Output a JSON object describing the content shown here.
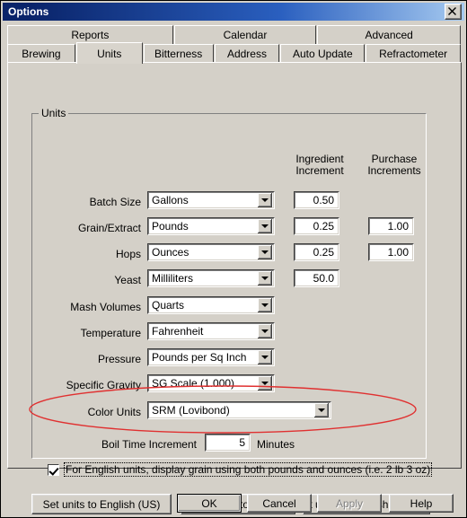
{
  "window": {
    "title": "Options",
    "close_icon": "close-icon"
  },
  "tabs": {
    "top_row": [
      {
        "label": "Reports",
        "selected": false
      },
      {
        "label": "Calendar",
        "selected": false
      },
      {
        "label": "Advanced",
        "selected": false
      }
    ],
    "bottom_row": [
      {
        "label": "Brewing",
        "selected": false
      },
      {
        "label": "Units",
        "selected": true
      },
      {
        "label": "Bitterness",
        "selected": false
      },
      {
        "label": "Address",
        "selected": false
      },
      {
        "label": "Auto Update",
        "selected": false
      },
      {
        "label": "Refractometer",
        "selected": false
      }
    ]
  },
  "group": {
    "legend": "Units",
    "columns": {
      "ingredient": "Ingredient\nIncrement",
      "ingredient_line1": "Ingredient",
      "ingredient_line2": "Increment",
      "purchase_line1": "Purchase",
      "purchase_line2": "Increments"
    },
    "rows": [
      {
        "label": "Batch Size",
        "unit": "Gallons",
        "ingredient": "0.50",
        "purchase": ""
      },
      {
        "label": "Grain/Extract",
        "unit": "Pounds",
        "ingredient": "0.25",
        "purchase": "1.00"
      },
      {
        "label": "Hops",
        "unit": "Ounces",
        "ingredient": "0.25",
        "purchase": "1.00"
      },
      {
        "label": "Yeast",
        "unit": "Milliliters",
        "ingredient": "50.0",
        "purchase": ""
      },
      {
        "label": "Mash Volumes",
        "unit": "Quarts",
        "ingredient": "",
        "purchase": ""
      },
      {
        "label": "Temperature",
        "unit": "Fahrenheit",
        "ingredient": "",
        "purchase": ""
      },
      {
        "label": "Pressure",
        "unit": "Pounds per Sq Inch",
        "ingredient": "",
        "purchase": ""
      },
      {
        "label": "Specific Gravity",
        "unit": "SG Scale (1.000)",
        "ingredient": "",
        "purchase": ""
      },
      {
        "label": "Color Units",
        "unit": "SRM (Lovibond)",
        "ingredient": "",
        "purchase": ""
      }
    ],
    "boil": {
      "label": "Boil Time Increment",
      "value": "5",
      "units": "Minutes"
    },
    "checkbox": {
      "checked": true,
      "label": "For English units, display grain using both pounds and ounces (i.e. 2 lb 3 oz)"
    }
  },
  "presets": [
    {
      "label": "Set units to English (US)"
    },
    {
      "label": "Set units to Metric"
    },
    {
      "label": "Set units to English (Imperial)"
    }
  ],
  "dialog_buttons": [
    {
      "label": "OK",
      "enabled": true,
      "default": true
    },
    {
      "label": "Cancel",
      "enabled": true,
      "default": false
    },
    {
      "label": "Apply",
      "enabled": false,
      "default": false
    },
    {
      "label": "Help",
      "enabled": true,
      "default": false
    }
  ],
  "annotation": {
    "shape": "ellipse",
    "color": "#e03030",
    "target": "english-units-checkbox"
  },
  "colors": {
    "face": "#d4d0c8",
    "title_left": "#0a246a",
    "title_right": "#a6caf0",
    "annotation_red": "#e03030"
  }
}
